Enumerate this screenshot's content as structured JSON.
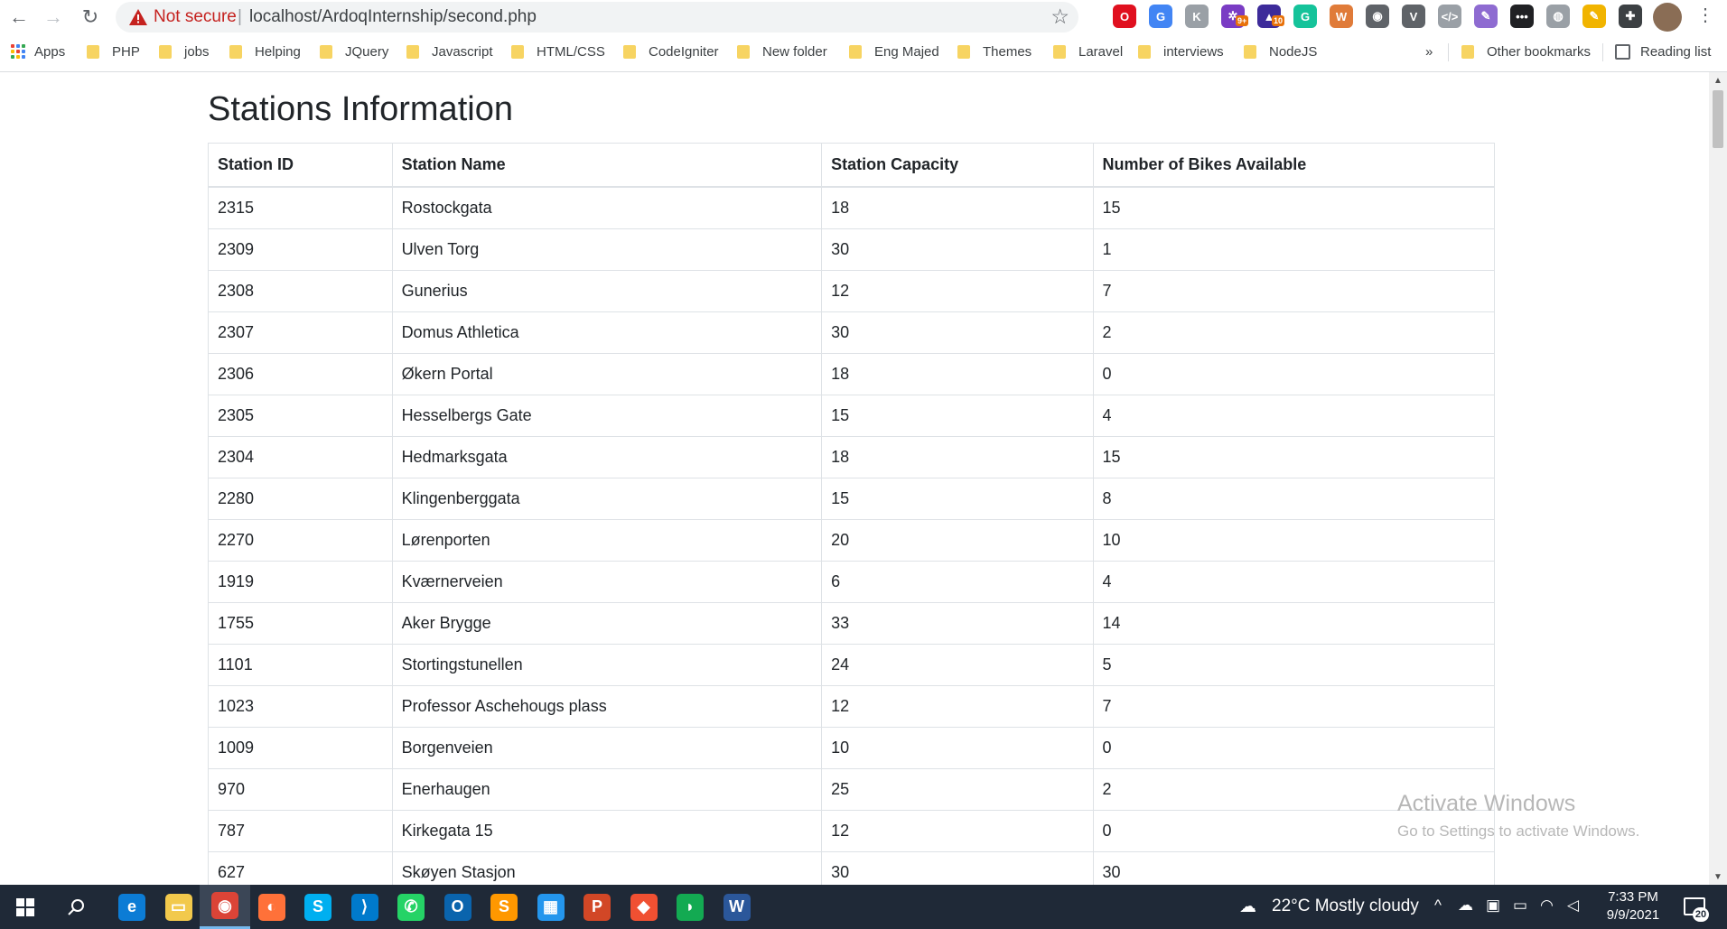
{
  "browser": {
    "security_label": "Not secure",
    "url": "localhost/ArdoqInternship/second.php",
    "extensions": [
      {
        "name": "opera-icon",
        "color": "#e0101f",
        "label": "O"
      },
      {
        "name": "google-translate-icon",
        "color": "#4285f4",
        "label": "G"
      },
      {
        "name": "extension-k-icon",
        "color": "#9aa0a6",
        "label": "K"
      },
      {
        "name": "color-picker-icon",
        "color": "#7a3cc4",
        "label": "✲",
        "badge": "9+"
      },
      {
        "name": "graduation-icon",
        "color": "#3d2b9a",
        "label": "▲",
        "badge": "10"
      },
      {
        "name": "grammarly-icon",
        "color": "#15c39a",
        "label": "G"
      },
      {
        "name": "wordpress-icon",
        "color": "#e07b39",
        "label": "W"
      },
      {
        "name": "camera-icon",
        "color": "#5f6368",
        "label": "◉"
      },
      {
        "name": "vue-devtools-icon",
        "color": "#5f6368",
        "label": "V"
      },
      {
        "name": "code-icon",
        "color": "#9aa0a6",
        "label": "</>"
      },
      {
        "name": "pen-icon",
        "color": "#8e6bd1",
        "label": "✎"
      },
      {
        "name": "dots-icon",
        "color": "#202124",
        "label": "•••"
      },
      {
        "name": "globe-icon",
        "color": "#9aa0a6",
        "label": "◍"
      },
      {
        "name": "highlighter-icon",
        "color": "#f1b400",
        "label": "✎"
      },
      {
        "name": "puzzle-icon",
        "color": "#3c4043",
        "label": "✚"
      }
    ],
    "bookmarks": [
      "Apps",
      "PHP",
      "jobs",
      "Helping",
      "JQuery",
      "Javascript",
      "HTML/CSS",
      "CodeIgniter",
      "New folder",
      "Eng Majed",
      "Themes",
      "Laravel",
      "interviews",
      "NodeJS"
    ],
    "more_bookmarks": "»",
    "other_bookmarks": "Other bookmarks",
    "reading_list": "Reading list"
  },
  "page": {
    "title": "Stations Information",
    "columns": [
      "Station ID",
      "Station Name",
      "Station Capacity",
      "Number of Bikes Available"
    ],
    "rows": [
      [
        "2315",
        "Rostockgata",
        "18",
        "15"
      ],
      [
        "2309",
        "Ulven Torg",
        "30",
        "1"
      ],
      [
        "2308",
        "Gunerius",
        "12",
        "7"
      ],
      [
        "2307",
        "Domus Athletica",
        "30",
        "2"
      ],
      [
        "2306",
        "Økern Portal",
        "18",
        "0"
      ],
      [
        "2305",
        "Hesselbergs Gate",
        "15",
        "4"
      ],
      [
        "2304",
        "Hedmarksgata",
        "18",
        "15"
      ],
      [
        "2280",
        "Klingenberggata",
        "15",
        "8"
      ],
      [
        "2270",
        "Lørenporten",
        "20",
        "10"
      ],
      [
        "1919",
        "Kværnerveien",
        "6",
        "4"
      ],
      [
        "1755",
        "Aker Brygge",
        "33",
        "14"
      ],
      [
        "1101",
        "Stortingstunellen",
        "24",
        "5"
      ],
      [
        "1023",
        "Professor Aschehougs plass",
        "12",
        "7"
      ],
      [
        "1009",
        "Borgenveien",
        "10",
        "0"
      ],
      [
        "970",
        "Enerhaugen",
        "25",
        "2"
      ],
      [
        "787",
        "Kirkegata 15",
        "12",
        "0"
      ],
      [
        "627",
        "Skøyen Stasjon",
        "30",
        "30"
      ]
    ]
  },
  "watermark": {
    "title": "Activate Windows",
    "subtitle": "Go to Settings to activate Windows."
  },
  "taskbar": {
    "apps": [
      {
        "name": "edge-icon",
        "color": "#0c7cd5",
        "label": "e"
      },
      {
        "name": "file-explorer-icon",
        "color": "#f2c94c",
        "label": "▭"
      },
      {
        "name": "chrome-icon",
        "color": "#db4437",
        "label": "◉",
        "active": true
      },
      {
        "name": "firefox-icon",
        "color": "#ff7139",
        "label": "◐"
      },
      {
        "name": "skype-icon",
        "color": "#00aff0",
        "label": "S"
      },
      {
        "name": "vscode-icon",
        "color": "#007acc",
        "label": "⟩"
      },
      {
        "name": "whatsapp-icon",
        "color": "#25d366",
        "label": "✆"
      },
      {
        "name": "outlook-icon",
        "color": "#0a64ad",
        "label": "O"
      },
      {
        "name": "sublime-icon",
        "color": "#ff9800",
        "label": "S"
      },
      {
        "name": "docker-icon",
        "color": "#2496ed",
        "label": "▦"
      },
      {
        "name": "powerpoint-icon",
        "color": "#d24726",
        "label": "P"
      },
      {
        "name": "git-icon",
        "color": "#f05032",
        "label": "◆"
      },
      {
        "name": "mongodb-icon",
        "color": "#13aa52",
        "label": "◗"
      },
      {
        "name": "word-icon",
        "color": "#2b579a",
        "label": "W"
      }
    ],
    "weather": "22°C  Mostly cloudy",
    "time": "7:33 PM",
    "date": "9/9/2021",
    "notifications": "20"
  }
}
